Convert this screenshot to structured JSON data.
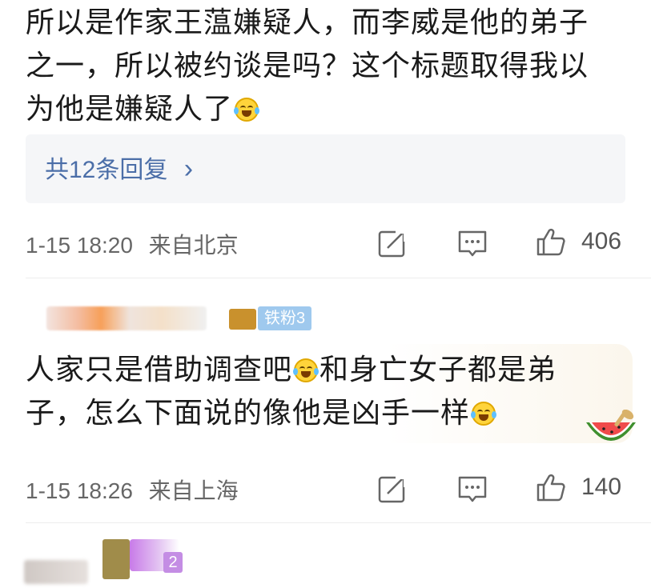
{
  "comment1": {
    "line1": "所以是作家王蕰嫌疑人，而李威是他的弟子",
    "line2": "之一，所以被约谈是吗？这个标题取得我以",
    "line3": "为他是嫌疑人了",
    "emoji": "laugh-cry-emoji",
    "replies_label": "共12条回复",
    "replies_chevron": "›",
    "timestamp": "1-15 18:20",
    "location": "来自北京",
    "like_count": "406"
  },
  "comment2": {
    "user_badge": "铁粉3",
    "line1a": "人家只是借助调查吧",
    "line1b": "和身亡女子都是弟",
    "line2": "子，怎么下面说的像他是凶手一样",
    "emoji": "laugh-cry-emoji",
    "sticker": "watermelon-sticker",
    "timestamp": "1-15 18:26",
    "location": "来自上海",
    "like_count": "140"
  },
  "comment3": {
    "user_badge": "2"
  },
  "colors": {
    "reply_link": "#4b6ea8",
    "badge_blue": "#9fc9ee",
    "badge_purple": "#c48de4",
    "meta_text": "#666666"
  }
}
